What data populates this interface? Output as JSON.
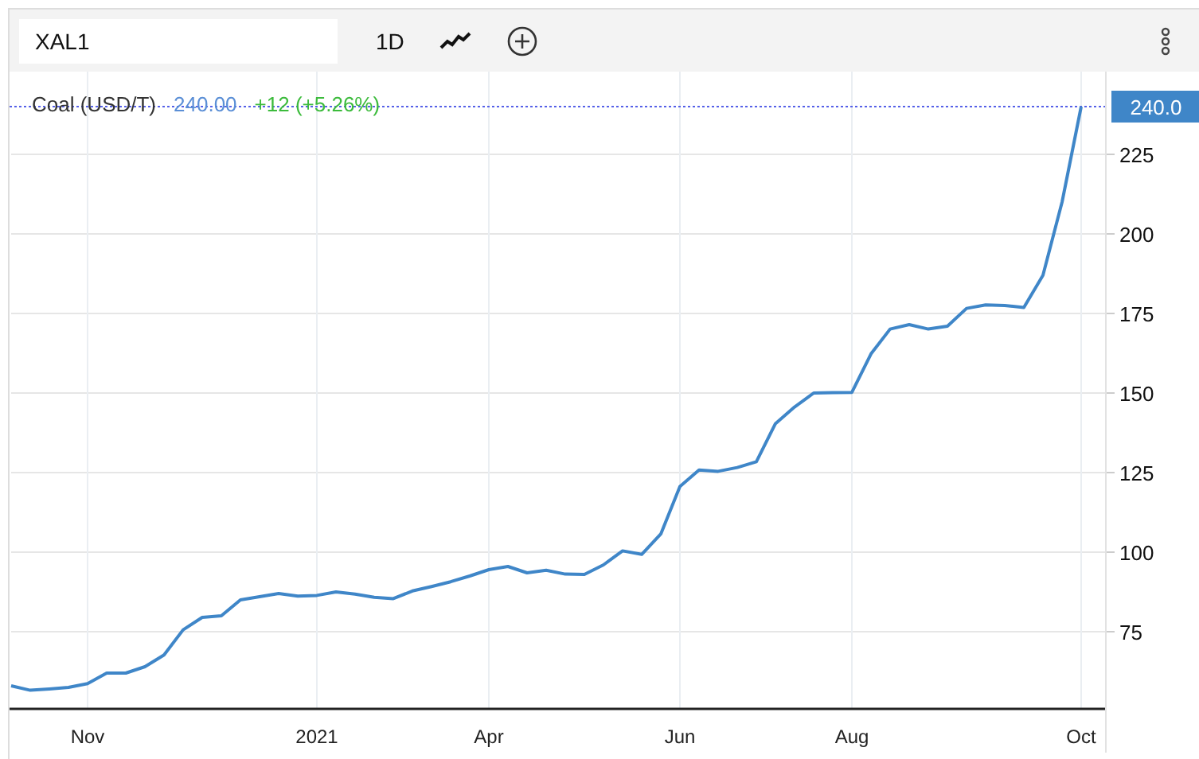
{
  "toolbar": {
    "symbol": "XAL1",
    "period": "1D"
  },
  "legend": {
    "price": "240.00",
    "change": "+12 (+5.26%)"
  },
  "chart": {
    "chart_data": {
      "type": "line",
      "ylim": [
        51,
        251
      ],
      "grid": true,
      "ref_lines": [
        {
          "axis": "y",
          "value": 240,
          "label": "240.0"
        }
      ],
      "categories": [
        null,
        null,
        null,
        null,
        "Nov",
        null,
        null,
        null,
        null,
        null,
        null,
        null,
        null,
        null,
        null,
        null,
        "2021",
        null,
        null,
        null,
        null,
        null,
        null,
        null,
        null,
        "Apr",
        null,
        null,
        null,
        null,
        null,
        null,
        null,
        null,
        null,
        "Jun",
        null,
        null,
        null,
        null,
        null,
        null,
        null,
        null,
        "Aug",
        null,
        null,
        null,
        null,
        null,
        null,
        null,
        null,
        null,
        null,
        null,
        "Oct"
      ],
      "yticks": [
        75,
        100,
        125,
        150,
        175,
        200,
        225
      ],
      "series": [
        {
          "name": "Coal (USD/T)",
          "color": "#3f86c8",
          "values": [
            58,
            56.6,
            57,
            57.5,
            58.7,
            62,
            62,
            64,
            67.7,
            75.6,
            79.5,
            80,
            85,
            86,
            87,
            86.2,
            86.4,
            87.5,
            86.8,
            85.8,
            85.4,
            87.8,
            89.2,
            90.7,
            92.5,
            94.5,
            95.5,
            93.5,
            94.3,
            93.1,
            93,
            96,
            100.4,
            99.3,
            105.7,
            120.6,
            125.8,
            125.4,
            126.6,
            128.4,
            140.4,
            145.6,
            150,
            150.1,
            150.2,
            162.3,
            170.1,
            171.5,
            170.1,
            171,
            176.6,
            177.7,
            177.5,
            176.9,
            187,
            210,
            240
          ]
        }
      ]
    }
  }
}
